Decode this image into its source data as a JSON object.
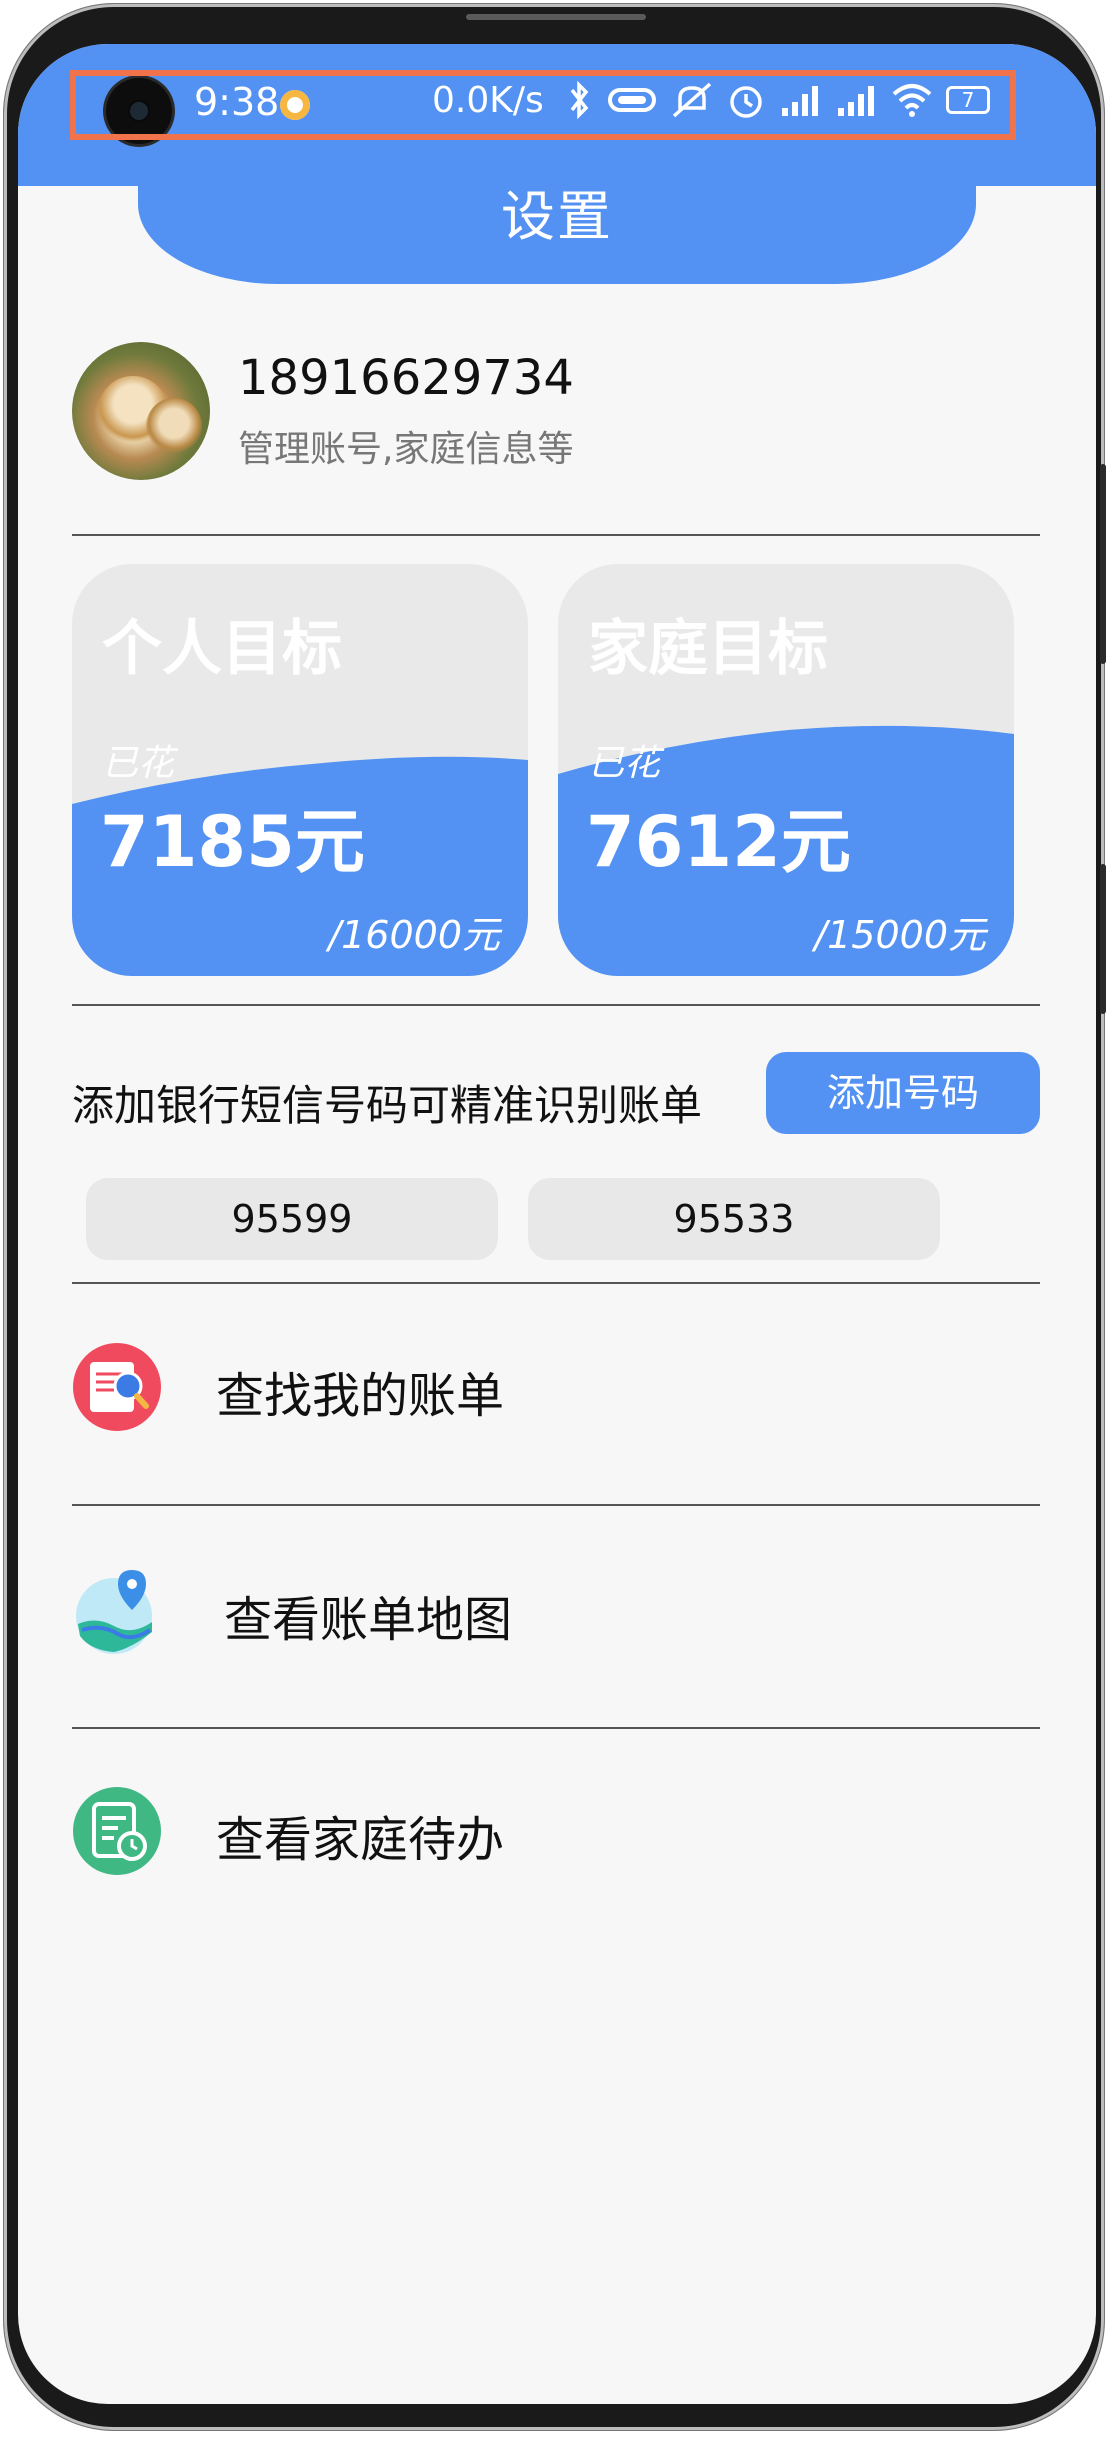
{
  "status_bar": {
    "time": "9:38",
    "net_speed": "0.0K/s",
    "battery_level": "7",
    "icons": [
      "bluetooth-icon",
      "vibrate-icon",
      "mute-icon",
      "alarm-icon",
      "signal-hd-icon",
      "signal-hd-icon",
      "wifi-icon",
      "battery-icon"
    ]
  },
  "header": {
    "title": "设置"
  },
  "profile": {
    "phone": "18916629734",
    "subtitle": "管理账号,家庭信息等"
  },
  "goals": [
    {
      "title": "个人目标",
      "spent_label": "已花",
      "spent": "7185元",
      "total": "/16000元",
      "progress": 0.449
    },
    {
      "title": "家庭目标",
      "spent_label": "已花",
      "spent": "7612元",
      "total": "/15000元",
      "progress": 0.507
    }
  ],
  "bank_sms": {
    "hint": "添加银行短信号码可精准识别账单",
    "add_button": "添加号码",
    "numbers": [
      "95599",
      "95533"
    ]
  },
  "menu": [
    {
      "label": "查找我的账单",
      "icon": "bill-search-icon"
    },
    {
      "label": "查看账单地图",
      "icon": "map-pin-icon"
    },
    {
      "label": "查看家庭待办",
      "icon": "todo-clock-icon"
    }
  ],
  "colors": {
    "accent": "#5392f2",
    "card_bg": "#e9e9e9",
    "status_highlight": "#f0734b"
  }
}
